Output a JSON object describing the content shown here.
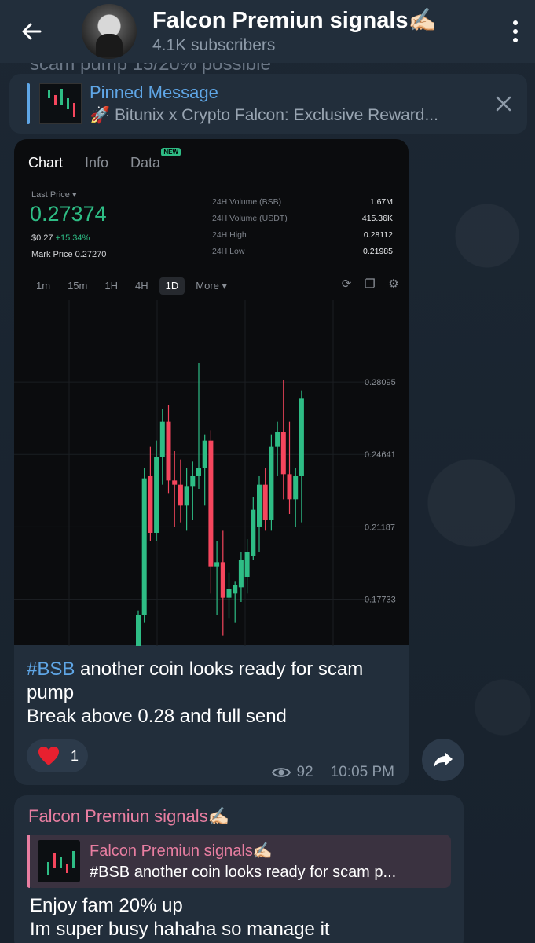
{
  "header": {
    "title": "Falcon Premiun signals✍🏻",
    "subtitle": "4.1K subscribers"
  },
  "scrolled_text": "scam pump 15/20% possible",
  "pinned": {
    "title": "Pinned Message",
    "message": "🚀 Bitunix x Crypto Falcon: Exclusive Reward..."
  },
  "post": {
    "chart": {
      "tabs": [
        "Chart",
        "Info",
        "Data"
      ],
      "new_badge": "NEW",
      "last_price_label": "Last Price ▾",
      "last_price": "0.27374",
      "usd_price": "$0.27",
      "change": "+15.34%",
      "mark_price": "Mark Price 0.27270",
      "stats": [
        {
          "label": "24H Volume (BSB)",
          "value": "1.67M"
        },
        {
          "label": "24H Volume (USDT)",
          "value": "415.36K"
        },
        {
          "label": "24H High",
          "value": "0.28112"
        },
        {
          "label": "24H Low",
          "value": "0.21985"
        }
      ],
      "intervals": [
        "1m",
        "15m",
        "1H",
        "4H",
        "1D",
        "More ▾"
      ],
      "selected_interval": "1D",
      "colors": {
        "up": "#2ebd85",
        "down": "#f6465d"
      }
    },
    "hashtag": "#BSB",
    "text_line1": " another coin looks ready for scam pump",
    "text_line2": "Break above 0.28 and full send",
    "reaction_count": "1",
    "views": "92",
    "time": "10:05 PM"
  },
  "post2": {
    "sender": "Falcon Premiun signals✍🏻",
    "reply_name": "Falcon Premiun signals✍🏻",
    "reply_msg": "#BSB another coin looks ready for scam p...",
    "line1": "Enjoy fam 20% up",
    "line2": "Im super busy hahaha so manage it"
  },
  "chart_data": {
    "type": "candlestick",
    "title": "",
    "y_ticks": [
      "0.28095",
      "0.24641",
      "0.21187",
      "0.17733"
    ],
    "ylim": [
      0.155,
      0.32
    ],
    "grid": true,
    "candles": [
      {
        "o": 0.155,
        "h": 0.172,
        "l": 0.15,
        "c": 0.17
      },
      {
        "o": 0.17,
        "h": 0.24,
        "l": 0.166,
        "c": 0.235
      },
      {
        "o": 0.236,
        "h": 0.25,
        "l": 0.205,
        "c": 0.209
      },
      {
        "o": 0.209,
        "h": 0.253,
        "l": 0.205,
        "c": 0.245
      },
      {
        "o": 0.245,
        "h": 0.268,
        "l": 0.232,
        "c": 0.262
      },
      {
        "o": 0.262,
        "h": 0.27,
        "l": 0.228,
        "c": 0.234
      },
      {
        "o": 0.234,
        "h": 0.248,
        "l": 0.212,
        "c": 0.232
      },
      {
        "o": 0.232,
        "h": 0.244,
        "l": 0.214,
        "c": 0.222
      },
      {
        "o": 0.222,
        "h": 0.24,
        "l": 0.21,
        "c": 0.231
      },
      {
        "o": 0.231,
        "h": 0.243,
        "l": 0.215,
        "c": 0.236
      },
      {
        "o": 0.236,
        "h": 0.29,
        "l": 0.23,
        "c": 0.24
      },
      {
        "o": 0.24,
        "h": 0.256,
        "l": 0.222,
        "c": 0.253
      },
      {
        "o": 0.253,
        "h": 0.258,
        "l": 0.18,
        "c": 0.193
      },
      {
        "o": 0.193,
        "h": 0.205,
        "l": 0.17,
        "c": 0.195
      },
      {
        "o": 0.195,
        "h": 0.21,
        "l": 0.16,
        "c": 0.178
      },
      {
        "o": 0.178,
        "h": 0.19,
        "l": 0.168,
        "c": 0.182
      },
      {
        "o": 0.18,
        "h": 0.186,
        "l": 0.166,
        "c": 0.184
      },
      {
        "o": 0.183,
        "h": 0.2,
        "l": 0.176,
        "c": 0.196
      },
      {
        "o": 0.188,
        "h": 0.206,
        "l": 0.18,
        "c": 0.2
      },
      {
        "o": 0.198,
        "h": 0.226,
        "l": 0.196,
        "c": 0.22
      },
      {
        "o": 0.212,
        "h": 0.236,
        "l": 0.2,
        "c": 0.232
      },
      {
        "o": 0.232,
        "h": 0.24,
        "l": 0.21,
        "c": 0.215
      },
      {
        "o": 0.215,
        "h": 0.256,
        "l": 0.21,
        "c": 0.25
      },
      {
        "o": 0.25,
        "h": 0.262,
        "l": 0.236,
        "c": 0.257
      },
      {
        "o": 0.257,
        "h": 0.282,
        "l": 0.225,
        "c": 0.237
      },
      {
        "o": 0.237,
        "h": 0.262,
        "l": 0.218,
        "c": 0.225
      },
      {
        "o": 0.225,
        "h": 0.24,
        "l": 0.212,
        "c": 0.236
      },
      {
        "o": 0.236,
        "h": 0.277,
        "l": 0.214,
        "c": 0.273
      }
    ]
  }
}
